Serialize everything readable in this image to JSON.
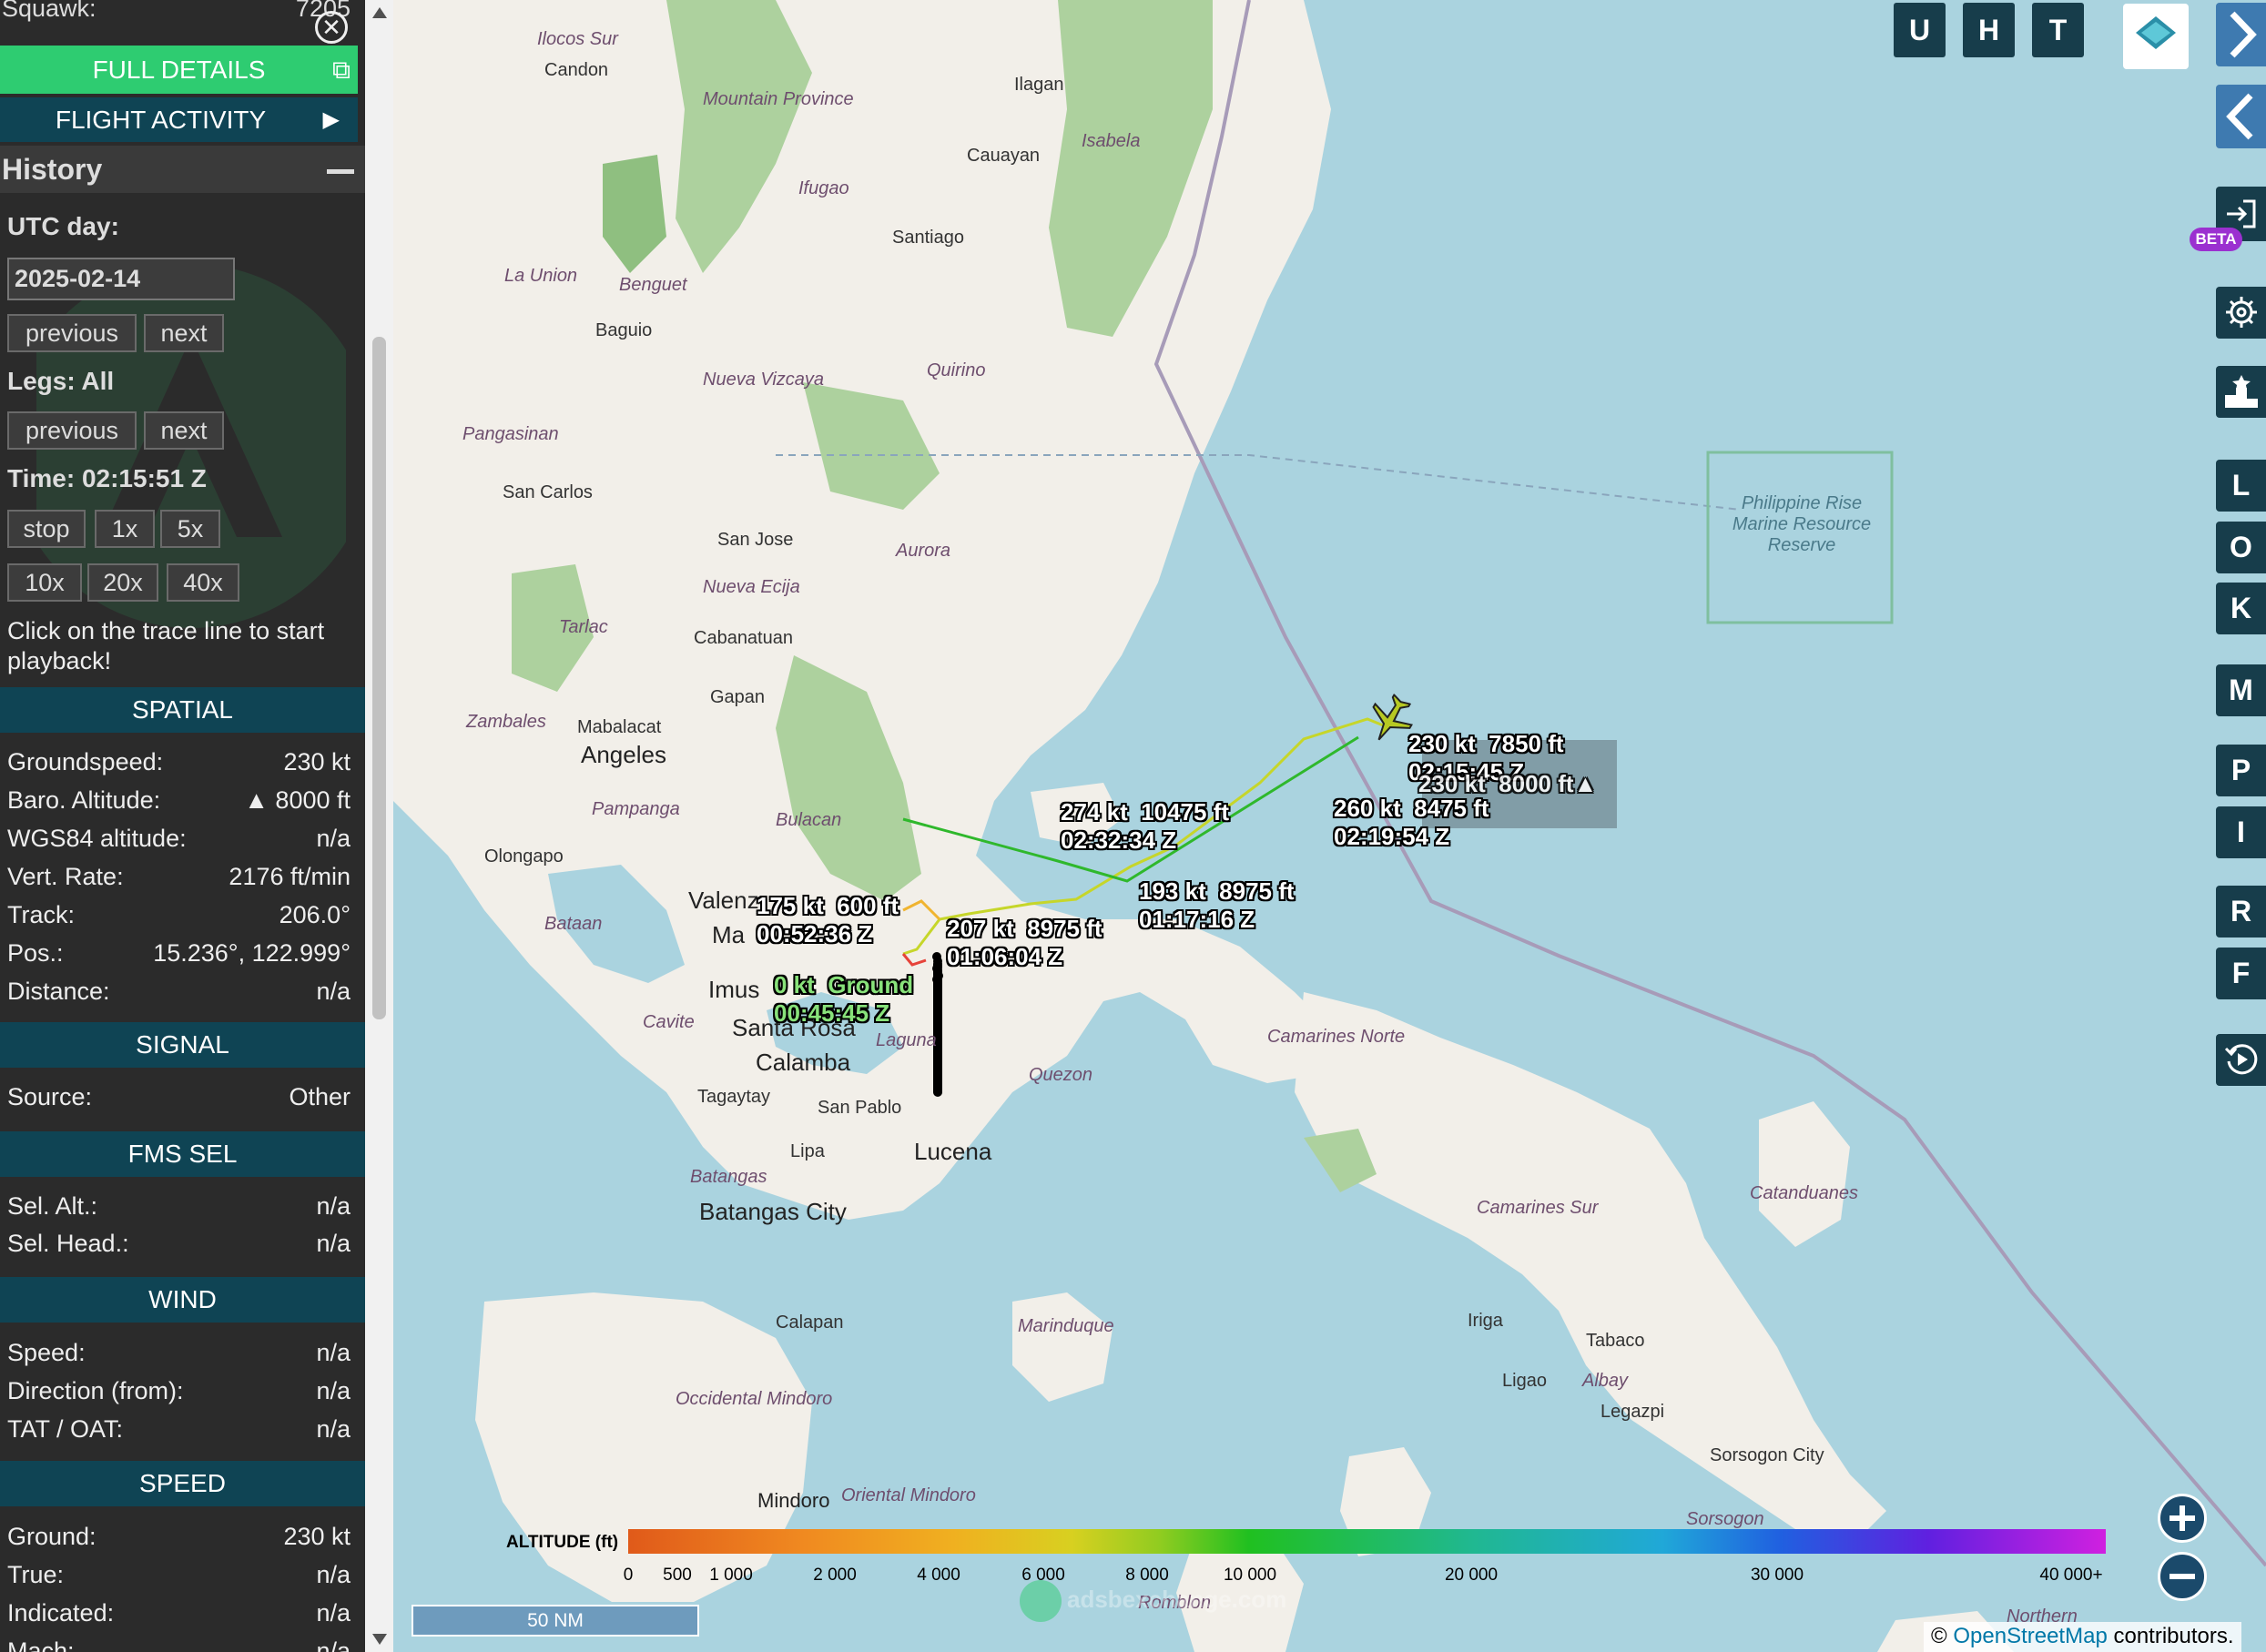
{
  "sidebar": {
    "squawk": {
      "label": "Squawk:",
      "value": "7205"
    },
    "full_details": "FULL DETAILS",
    "flight_activity": "FLIGHT ACTIVITY",
    "history": {
      "title": "History",
      "utc_day_label": "UTC day:",
      "utc_day_value": "2025-02-14",
      "previous": "previous",
      "next": "next",
      "legs_label": "Legs: All",
      "time_label": "Time: 02:15:51 Z",
      "stop": "stop",
      "speeds": [
        "1x",
        "5x",
        "10x",
        "20x",
        "40x"
      ],
      "hint": "Click on the trace line to start playback!"
    },
    "spatial": {
      "title": "SPATIAL",
      "rows": [
        {
          "k": "Groundspeed:",
          "v": "230 kt"
        },
        {
          "k": "Baro. Altitude:",
          "v": "▲ 8000 ft"
        },
        {
          "k": "WGS84 altitude:",
          "v": "n/a"
        },
        {
          "k": "Vert. Rate:",
          "v": "2176 ft/min"
        },
        {
          "k": "Track:",
          "v": "206.0°"
        },
        {
          "k": "Pos.:",
          "v": "15.236°, 122.999°"
        },
        {
          "k": "Distance:",
          "v": "n/a"
        }
      ]
    },
    "signal": {
      "title": "SIGNAL",
      "rows": [
        {
          "k": "Source:",
          "v": "Other"
        }
      ]
    },
    "fms_sel": {
      "title": "FMS SEL",
      "rows": [
        {
          "k": "Sel. Alt.:",
          "v": "n/a"
        },
        {
          "k": "Sel. Head.:",
          "v": "n/a"
        }
      ]
    },
    "wind": {
      "title": "WIND",
      "rows": [
        {
          "k": "Speed:",
          "v": "n/a"
        },
        {
          "k": "Direction (from):",
          "v": "n/a"
        },
        {
          "k": "TAT / OAT:",
          "v": "n/a"
        }
      ]
    },
    "speed": {
      "title": "SPEED",
      "rows": [
        {
          "k": "Ground:",
          "v": "230 kt"
        },
        {
          "k": "True:",
          "v": "n/a"
        },
        {
          "k": "Indicated:",
          "v": "n/a"
        },
        {
          "k": "Mach:",
          "v": "n/a"
        }
      ]
    }
  },
  "map": {
    "top_buttons": [
      "U",
      "H",
      "T"
    ],
    "right_buttons": [
      "L",
      "O",
      "K",
      "M",
      "P",
      "I",
      "R",
      "F"
    ],
    "beta": "BETA",
    "places": [
      {
        "n": "Ilocos Sur",
        "c": "it"
      },
      {
        "n": "Candon",
        "c": ""
      },
      {
        "n": "Mountain Province",
        "c": "it"
      },
      {
        "n": "Ilagan",
        "c": ""
      },
      {
        "n": "Isabela",
        "c": "it"
      },
      {
        "n": "Cauayan",
        "c": ""
      },
      {
        "n": "Ifugao",
        "c": "it"
      },
      {
        "n": "Santiago",
        "c": ""
      },
      {
        "n": "La Union",
        "c": "it"
      },
      {
        "n": "Benguet",
        "c": "it"
      },
      {
        "n": "Baguio",
        "c": ""
      },
      {
        "n": "Nueva Vizcaya",
        "c": "it"
      },
      {
        "n": "Quirino",
        "c": "it"
      },
      {
        "n": "Pangasinan",
        "c": "it"
      },
      {
        "n": "San Carlos",
        "c": ""
      },
      {
        "n": "San Jose",
        "c": ""
      },
      {
        "n": "Aurora",
        "c": "it"
      },
      {
        "n": "Nueva Ecija",
        "c": "it"
      },
      {
        "n": "Tarlac",
        "c": "it"
      },
      {
        "n": "Cabanatuan",
        "c": ""
      },
      {
        "n": "Zambales",
        "c": "it"
      },
      {
        "n": "Gapan",
        "c": ""
      },
      {
        "n": "Mabalacat",
        "c": ""
      },
      {
        "n": "Angeles",
        "c": "big"
      },
      {
        "n": "Pampanga",
        "c": "it"
      },
      {
        "n": "Bulacan",
        "c": "it"
      },
      {
        "n": "Olongapo",
        "c": ""
      },
      {
        "n": "Bataan",
        "c": "it"
      },
      {
        "n": "Valenz",
        "c": "big"
      },
      {
        "n": "Ma",
        "c": "big"
      },
      {
        "n": "Imus",
        "c": "big"
      },
      {
        "n": "Cavite",
        "c": "it"
      },
      {
        "n": "Santa Rosa",
        "c": "big"
      },
      {
        "n": "Laguna",
        "c": "it"
      },
      {
        "n": "Calamba",
        "c": "big"
      },
      {
        "n": "Tagaytay",
        "c": ""
      },
      {
        "n": "San Pablo",
        "c": ""
      },
      {
        "n": "Quezon",
        "c": "it"
      },
      {
        "n": "Lucena",
        "c": "big"
      },
      {
        "n": "Lipa",
        "c": ""
      },
      {
        "n": "Batangas",
        "c": "it"
      },
      {
        "n": "Batangas City",
        "c": "big"
      },
      {
        "n": "Camarines Norte",
        "c": "it"
      },
      {
        "n": "Camarines Sur",
        "c": "it"
      },
      {
        "n": "Catanduanes",
        "c": "it"
      },
      {
        "n": "Iriga",
        "c": ""
      },
      {
        "n": "Tabaco",
        "c": ""
      },
      {
        "n": "Ligao",
        "c": ""
      },
      {
        "n": "Albay",
        "c": "it"
      },
      {
        "n": "Legazpi",
        "c": ""
      },
      {
        "n": "Sorsogon City",
        "c": ""
      },
      {
        "n": "Sorsogon",
        "c": "it"
      },
      {
        "n": "Calapan",
        "c": ""
      },
      {
        "n": "Marinduque",
        "c": "it"
      },
      {
        "n": "Occidental Mindoro",
        "c": "it"
      },
      {
        "n": "Oriental Mindoro",
        "c": "it"
      },
      {
        "n": "Mindoro",
        "c": "big"
      },
      {
        "n": "Romblon",
        "c": "it"
      },
      {
        "n": "Northern",
        "c": "it"
      }
    ],
    "reserve": "Philippine Rise Marine Resource Reserve",
    "labels": [
      {
        "a": "230 kt  7850 ft",
        "b": "02:15:45 Z",
        "g": false
      },
      {
        "a": "230 kt  8000 ft▲",
        "b": "",
        "g": false
      },
      {
        "a": "260 kt  8475 ft",
        "b": "02:19:54 Z",
        "g": false
      },
      {
        "a": "274 kt  10475 ft",
        "b": "02:32:34 Z",
        "g": false
      },
      {
        "a": "193 kt  8975 ft",
        "b": "01:17:16 Z",
        "g": false
      },
      {
        "a": "207 kt  8975 ft",
        "b": "01:06:04 Z",
        "g": false
      },
      {
        "a": "175 kt  600 ft",
        "b": "00:52:36 Z",
        "g": false
      },
      {
        "a": "0 kt  Ground",
        "b": "00:45:45 Z",
        "g": true
      }
    ],
    "altitude_legend": {
      "title": "ALTITUDE (ft)",
      "ticks": [
        "0",
        "500",
        "1 000",
        "2 000",
        "4 000",
        "6 000",
        "8 000",
        "10 000",
        "20 000",
        "30 000",
        "40 000+"
      ]
    },
    "scale": "50 NM",
    "watermark": "adsbexchange.com",
    "attribution": {
      "prefix": "©",
      "link": "OpenStreetMap",
      "suffix": "contributors."
    },
    "colors": {
      "panel": "#2b2b2b",
      "section": "#0f4454",
      "full_details": "#2ecc71",
      "map_button": "#173d4b",
      "water": "#aad3df",
      "land": "#f2efe9"
    }
  }
}
